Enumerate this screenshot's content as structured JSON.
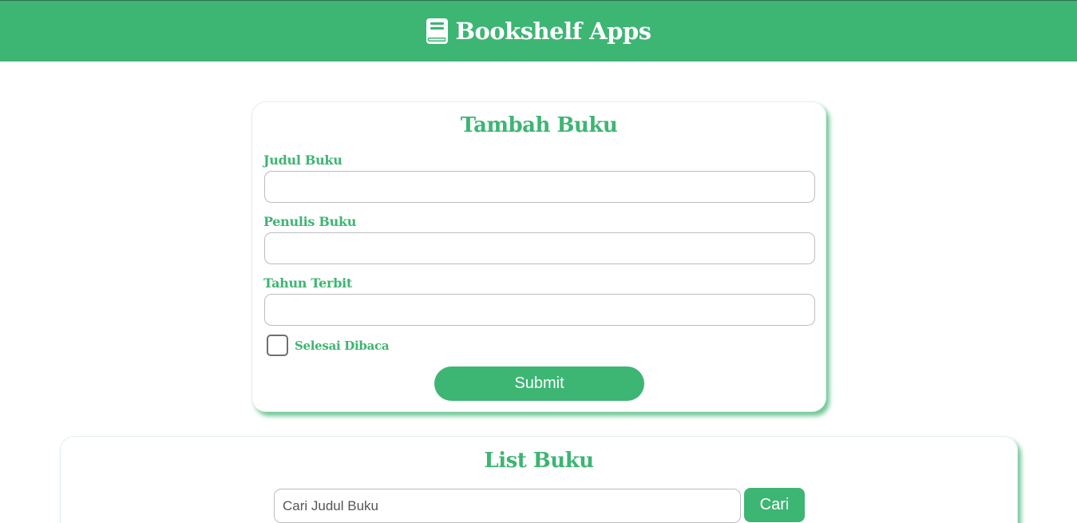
{
  "header": {
    "title": "Bookshelf Apps",
    "icon": "book-icon"
  },
  "colors": {
    "accent": "#3db573",
    "text_on_accent": "#ffffff",
    "input_border": "#bdbdbd"
  },
  "add_form": {
    "title": "Tambah Buku",
    "fields": [
      {
        "label": "Judul Buku",
        "value": ""
      },
      {
        "label": "Penulis Buku",
        "value": ""
      },
      {
        "label": "Tahun Terbit",
        "value": ""
      }
    ],
    "checkbox": {
      "label": "Selesai Dibaca",
      "checked": false
    },
    "submit_label": "Submit"
  },
  "list_section": {
    "title": "List Buku",
    "search": {
      "placeholder": "Cari Judul Buku",
      "value": "",
      "button_label": "Cari"
    }
  }
}
